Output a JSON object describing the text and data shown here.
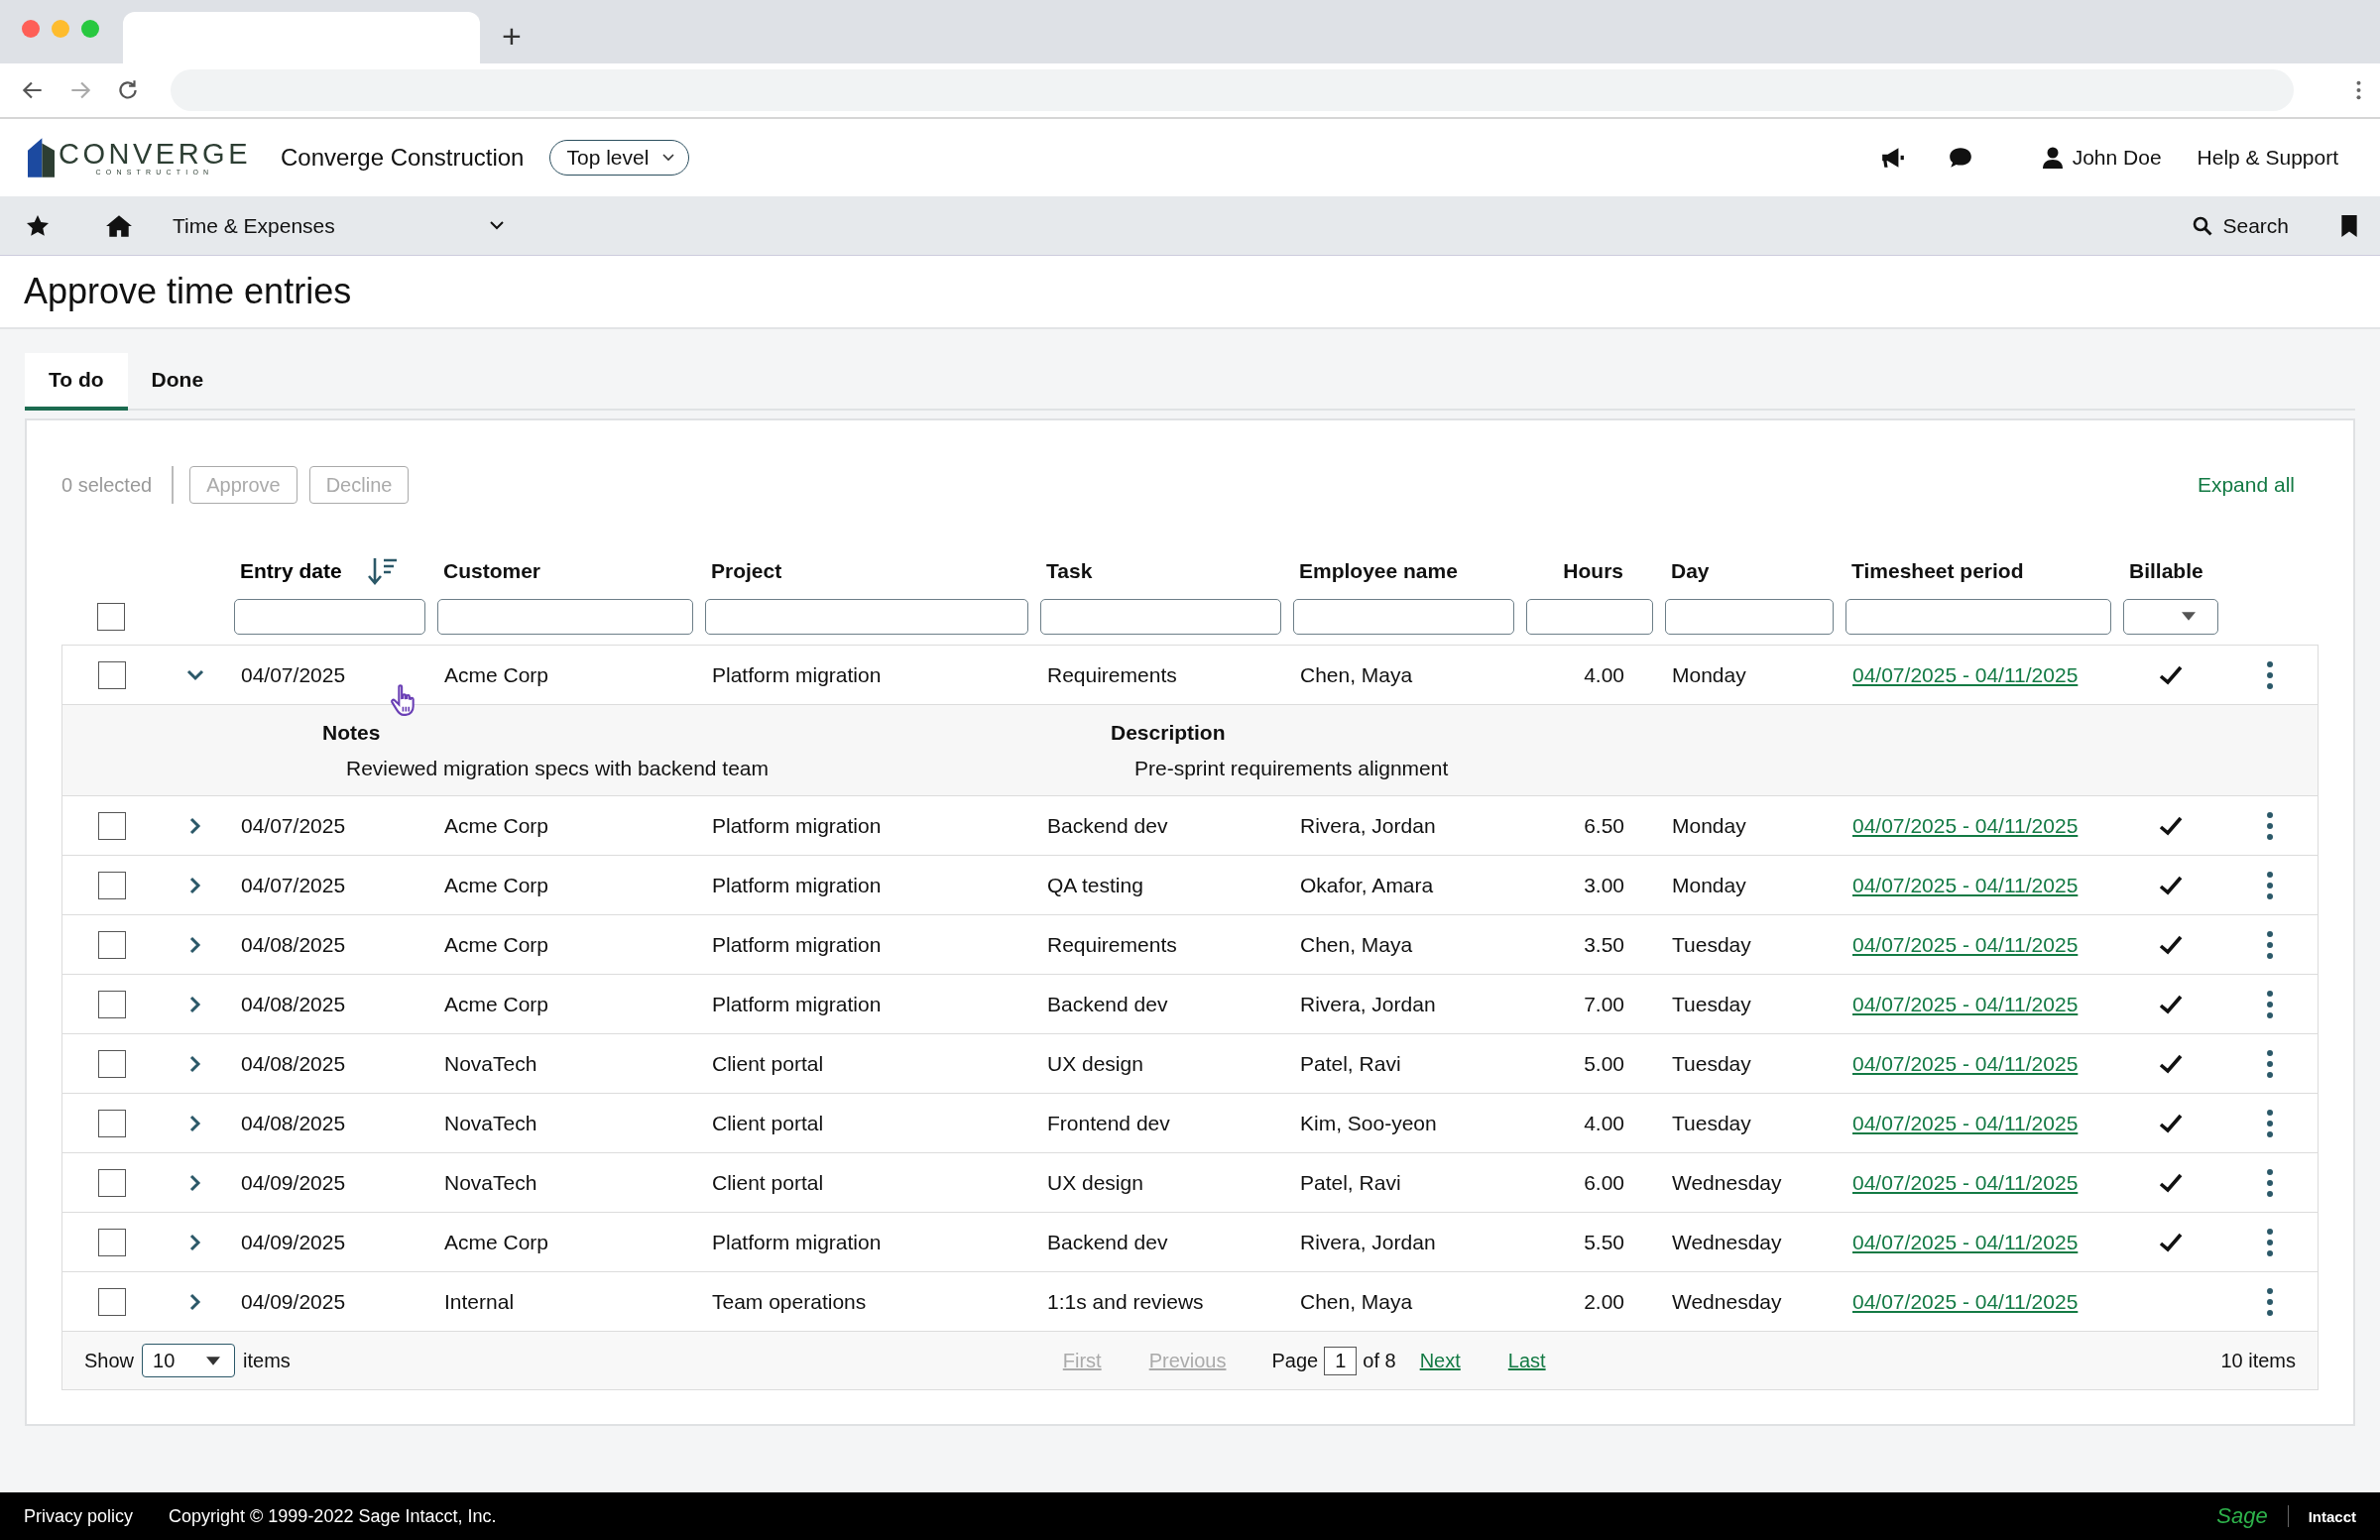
{
  "browser": {
    "new_tab": "+"
  },
  "header": {
    "logo": {
      "name": "CONVERGE",
      "tagline": "CONSTRUCTION"
    },
    "company": "Converge Construction",
    "level_select": "Top level",
    "user": "John Doe",
    "help": "Help & Support"
  },
  "nav": {
    "module": "Time & Expenses",
    "search": "Search"
  },
  "page_title": "Approve time entries",
  "tabs": [
    {
      "label": "To do",
      "selected": true
    },
    {
      "label": "Done",
      "selected": false
    }
  ],
  "toolbar": {
    "selected_count": "0 selected",
    "buttons": [
      {
        "label": "Approve",
        "disabled": true
      },
      {
        "label": "Decline",
        "disabled": true
      }
    ],
    "expand_all": "Expand all"
  },
  "table": {
    "columns": [
      {
        "label": "Entry date",
        "sorted": true
      },
      {
        "label": "Customer",
        "sorted": false
      },
      {
        "label": "Project",
        "sorted": false
      },
      {
        "label": "Task",
        "sorted": false
      },
      {
        "label": "Employee name",
        "sorted": false
      },
      {
        "label": "Hours",
        "sorted": false
      },
      {
        "label": "Day",
        "sorted": false
      },
      {
        "label": "Timesheet period",
        "sorted": false
      },
      {
        "label": "Billable",
        "sorted": false
      }
    ],
    "select_all_checked": false,
    "rows": [
      {
        "checked": false,
        "expanded": true,
        "date": "04/07/2025",
        "customer": "Acme Corp",
        "project": "Platform migration",
        "task": "Requirements",
        "employee": "Chen, Maya",
        "hours": "4.00",
        "day": "Monday",
        "period": "04/07/2025 - 04/11/2025",
        "billable": true,
        "details": [
          {
            "label": "Notes",
            "value": "Reviewed migration specs with backend team"
          },
          {
            "label": "Description",
            "value": "Pre-sprint requirements alignment"
          }
        ]
      },
      {
        "checked": false,
        "expanded": false,
        "date": "04/07/2025",
        "customer": "Acme Corp",
        "project": "Platform migration",
        "task": "Backend dev",
        "employee": "Rivera, Jordan",
        "hours": "6.50",
        "day": "Monday",
        "period": "04/07/2025 - 04/11/2025",
        "billable": true
      },
      {
        "checked": false,
        "expanded": false,
        "date": "04/07/2025",
        "customer": "Acme Corp",
        "project": "Platform migration",
        "task": "QA testing",
        "employee": "Okafor, Amara",
        "hours": "3.00",
        "day": "Monday",
        "period": "04/07/2025 - 04/11/2025",
        "billable": true
      },
      {
        "checked": false,
        "expanded": false,
        "date": "04/08/2025",
        "customer": "Acme Corp",
        "project": "Platform migration",
        "task": "Requirements",
        "employee": "Chen, Maya",
        "hours": "3.50",
        "day": "Tuesday",
        "period": "04/07/2025 - 04/11/2025",
        "billable": true
      },
      {
        "checked": false,
        "expanded": false,
        "date": "04/08/2025",
        "customer": "Acme Corp",
        "project": "Platform migration",
        "task": "Backend dev",
        "employee": "Rivera, Jordan",
        "hours": "7.00",
        "day": "Tuesday",
        "period": "04/07/2025 - 04/11/2025",
        "billable": true
      },
      {
        "checked": false,
        "expanded": false,
        "date": "04/08/2025",
        "customer": "NovaTech",
        "project": "Client portal",
        "task": "UX design",
        "employee": "Patel, Ravi",
        "hours": "5.00",
        "day": "Tuesday",
        "period": "04/07/2025 - 04/11/2025",
        "billable": true
      },
      {
        "checked": false,
        "expanded": false,
        "date": "04/08/2025",
        "customer": "NovaTech",
        "project": "Client portal",
        "task": "Frontend dev",
        "employee": "Kim, Soo-yeon",
        "hours": "4.00",
        "day": "Tuesday",
        "period": "04/07/2025 - 04/11/2025",
        "billable": true
      },
      {
        "checked": false,
        "expanded": false,
        "date": "04/09/2025",
        "customer": "NovaTech",
        "project": "Client portal",
        "task": "UX design",
        "employee": "Patel, Ravi",
        "hours": "6.00",
        "day": "Wednesday",
        "period": "04/07/2025 - 04/11/2025",
        "billable": true
      },
      {
        "checked": false,
        "expanded": false,
        "date": "04/09/2025",
        "customer": "Acme Corp",
        "project": "Platform migration",
        "task": "Backend dev",
        "employee": "Rivera, Jordan",
        "hours": "5.50",
        "day": "Wednesday",
        "period": "04/07/2025 - 04/11/2025",
        "billable": true
      },
      {
        "checked": false,
        "expanded": false,
        "date": "04/09/2025",
        "customer": "Internal",
        "project": "Team operations",
        "task": "1:1s and reviews",
        "employee": "Chen, Maya",
        "hours": "2.00",
        "day": "Wednesday",
        "period": "04/07/2025 - 04/11/2025",
        "billable": false
      }
    ]
  },
  "pagination": {
    "show_label": "Show",
    "page_size": "10",
    "items_label": "items",
    "links": [
      {
        "label": "First",
        "disabled": true
      },
      {
        "label": "Previous",
        "disabled": true
      }
    ],
    "page_label": "Page",
    "page": "1",
    "of_label": "of 8",
    "next_links": [
      {
        "label": "Next",
        "disabled": false
      },
      {
        "label": "Last",
        "disabled": false
      }
    ],
    "total": "10 items"
  },
  "footer": {
    "privacy": "Privacy policy",
    "copyright": "Copyright © 1999-2022 Sage Intacct, Inc.",
    "brand": "Sage",
    "product": "Intacct"
  }
}
